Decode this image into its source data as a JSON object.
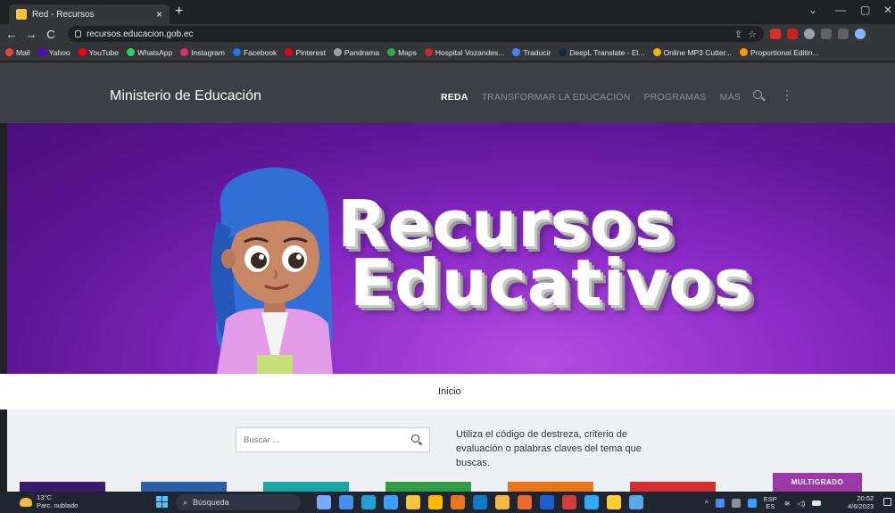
{
  "browser": {
    "tab_title": "Red - Recursos",
    "tab_close": "×",
    "new_tab": "+",
    "url": "recursos.educacion.gob.ec",
    "window_controls": [
      "⌄",
      "—",
      "▢",
      "✕"
    ]
  },
  "bookmarks": [
    {
      "label": "Mail",
      "color": "#ea4335"
    },
    {
      "label": "Yahoo",
      "color": "#6001d2"
    },
    {
      "label": "YouTube",
      "color": "#ff0000"
    },
    {
      "label": "WhatsApp",
      "color": "#25d366"
    },
    {
      "label": "Instagram",
      "color": "#e1306c"
    },
    {
      "label": "Facebook",
      "color": "#1877f2"
    },
    {
      "label": "Pinterest",
      "color": "#e60023"
    },
    {
      "label": "Pandrama",
      "color": "#9aa0a6"
    },
    {
      "label": "Maps",
      "color": "#34a853"
    },
    {
      "label": "Hospital Vozandes...",
      "color": "#c62828"
    },
    {
      "label": "Traducir",
      "color": "#4285f4"
    },
    {
      "label": "DeepL Translate - El...",
      "color": "#0f2b46"
    },
    {
      "label": "Online MP3 Cutter...",
      "color": "#f4b400"
    },
    {
      "label": "Proportional Editin...",
      "color": "#ff9800"
    }
  ],
  "site": {
    "brand": "Ministerio de Educación",
    "menu": [
      {
        "label": "REDA",
        "active": true
      },
      {
        "label": "TRANSFORMAR LA EDUCACIÓN",
        "active": false
      },
      {
        "label": "PROGRAMAS",
        "active": false
      },
      {
        "label": "MÁS",
        "active": false
      }
    ],
    "hero_line1": "Recursos",
    "hero_line2": "Educativos",
    "breadcrumb": "Inicio",
    "search_placeholder": "Buscar ...",
    "help_text": "Utiliza el código de destreza, criterio de evaluación o palabras claves del tema que buscas.",
    "card_label": "MULTIGRADO",
    "card_colors": [
      "#3a1a6e",
      "#2a5fa8",
      "#1aa6a6",
      "#2f9e44",
      "#e8761c",
      "#d32f2f"
    ],
    "hero_colors": {
      "bg": "#8c2bc9",
      "hair": "#2f6fd6",
      "jacket": "#e39ae8"
    }
  },
  "taskbar": {
    "temp": "13°C",
    "weather": "Parc. nublado",
    "search_label": "Búsqueda",
    "lang_top": "ESP",
    "lang_bottom": "ES",
    "time": "20:52",
    "date": "4/6/2023",
    "apps": [
      "#7aa7ff",
      "#4a8ff0",
      "#1fa3d4",
      "#3aa0ff",
      "#f5c542",
      "#ffb900",
      "#e8761c",
      "#0f7cc9",
      "#f2b94a",
      "#ea6b2b",
      "#1e5fcf",
      "#d13c3c",
      "#31a8ff",
      "#ffcc33",
      "#5aa9e6"
    ]
  }
}
